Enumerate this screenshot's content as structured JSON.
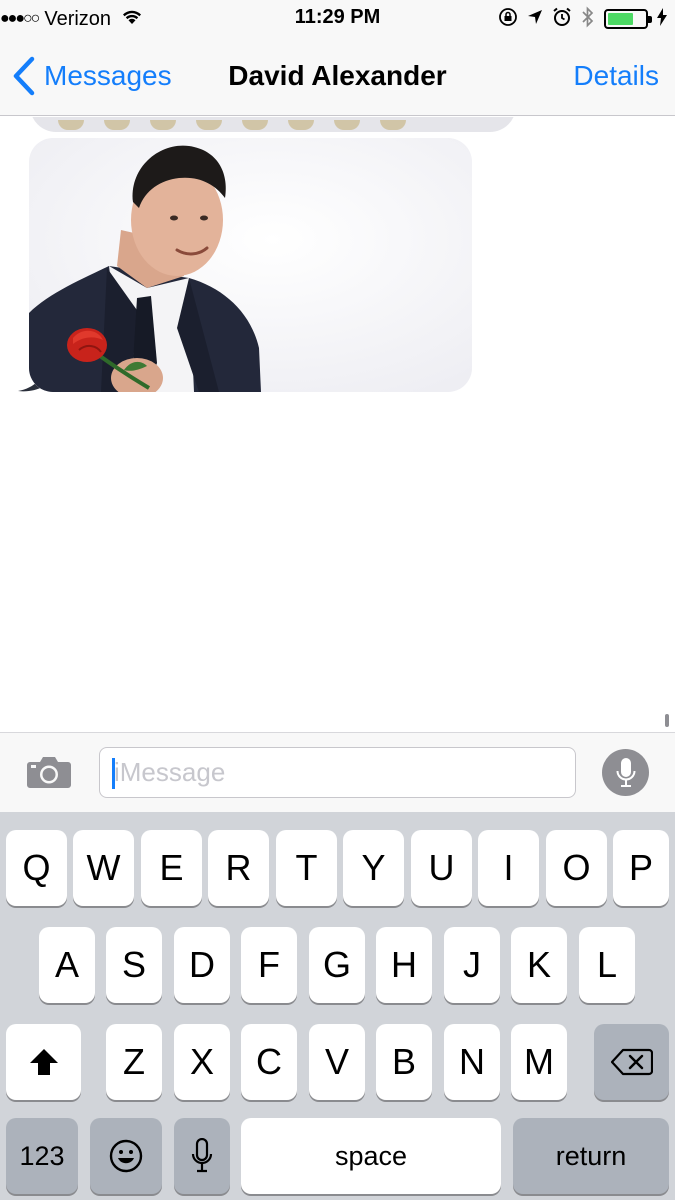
{
  "status_bar": {
    "signal": "●●●○○",
    "carrier": "Verizon",
    "time": "11:29 PM",
    "battery_level": 0.7,
    "icons": [
      "wifi-icon",
      "rotation-lock-icon",
      "location-icon",
      "alarm-icon",
      "bluetooth-icon",
      "battery-icon",
      "charging-icon"
    ]
  },
  "nav": {
    "back_label": "Messages",
    "title": "David Alexander",
    "details_label": "Details"
  },
  "messages": {
    "items": [
      {
        "kind": "received-partial",
        "content": "emoji"
      },
      {
        "kind": "received-image",
        "content": "photo of a man in a dark suit holding a red rose"
      }
    ]
  },
  "input": {
    "placeholder": "iMessage",
    "value": ""
  },
  "keyboard": {
    "row1": [
      "Q",
      "W",
      "E",
      "R",
      "T",
      "Y",
      "U",
      "I",
      "O",
      "P"
    ],
    "row2": [
      "A",
      "S",
      "D",
      "F",
      "G",
      "H",
      "J",
      "K",
      "L"
    ],
    "row3": [
      "Z",
      "X",
      "C",
      "V",
      "B",
      "N",
      "M"
    ],
    "numbers_label": "123",
    "space_label": "space",
    "return_label": "return"
  },
  "colors": {
    "accent": "#147efb",
    "bubble_gray": "#e5e5ea",
    "keyboard_bg": "#d1d4d9",
    "key_dark": "#acb2bb",
    "battery_green": "#4cd964"
  }
}
